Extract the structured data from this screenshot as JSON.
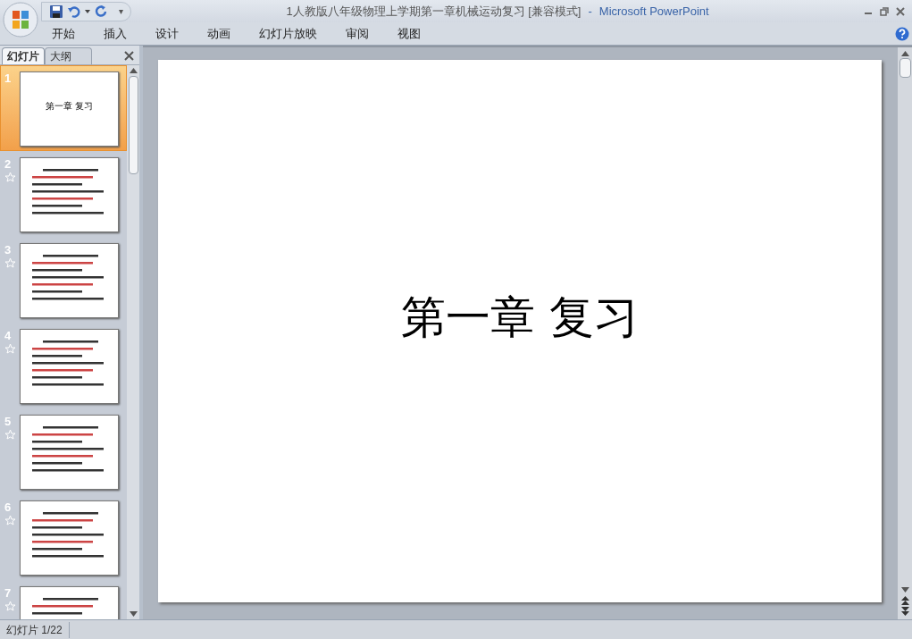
{
  "window": {
    "title": "1人教版八年级物理上学期第一章机械运动复习 [兼容模式]",
    "separator": "-",
    "app_name": "Microsoft PowerPoint"
  },
  "quick_access": {
    "menu_glyph": "▾"
  },
  "ribbon_tabs": [
    "开始",
    "插入",
    "设计",
    "动画",
    "幻灯片放映",
    "审阅",
    "视图"
  ],
  "pane_tabs": [
    {
      "label": "幻灯片",
      "selected": true
    },
    {
      "label": "大纲",
      "selected": false
    }
  ],
  "slides": [
    {
      "number": "1",
      "kind": "title",
      "title": "第一章 复习",
      "selected": true,
      "has_animation": false
    },
    {
      "number": "2",
      "kind": "text",
      "selected": false,
      "has_animation": true
    },
    {
      "number": "3",
      "kind": "text",
      "selected": false,
      "has_animation": true
    },
    {
      "number": "4",
      "kind": "text",
      "selected": false,
      "has_animation": true
    },
    {
      "number": "5",
      "kind": "text",
      "selected": false,
      "has_animation": true
    },
    {
      "number": "6",
      "kind": "text",
      "selected": false,
      "has_animation": true
    },
    {
      "number": "7",
      "kind": "text",
      "selected": false,
      "has_animation": true
    }
  ],
  "current_slide": {
    "title": "第一章 复习"
  },
  "status_bar": {
    "slide_indicator": "幻灯片 1/22"
  }
}
